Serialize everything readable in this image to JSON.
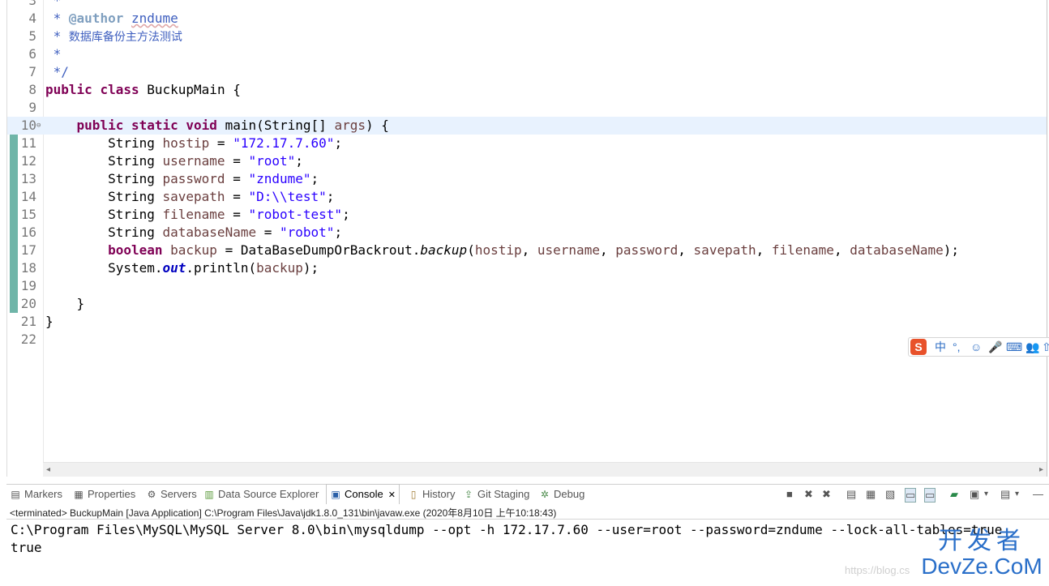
{
  "editor": {
    "lines": [
      {
        "n": "3",
        "segs": [
          {
            "t": " *",
            "c": "cm"
          }
        ]
      },
      {
        "n": "4",
        "segs": [
          {
            "t": " * ",
            "c": "cm"
          },
          {
            "t": "@author",
            "c": "tag"
          },
          {
            "t": " ",
            "c": "cm"
          },
          {
            "t": "zndume",
            "c": "tagv"
          }
        ]
      },
      {
        "n": "5",
        "segs": [
          {
            "t": " * ",
            "c": "cm"
          },
          {
            "t": "数据库备份主方法测试",
            "c": "cm cjk"
          }
        ]
      },
      {
        "n": "6",
        "segs": [
          {
            "t": " *",
            "c": "cm"
          }
        ]
      },
      {
        "n": "7",
        "segs": [
          {
            "t": " */",
            "c": "cm"
          }
        ]
      },
      {
        "n": "8",
        "segs": [
          {
            "t": "public",
            "c": "kw"
          },
          {
            "t": " "
          },
          {
            "t": "class",
            "c": "kw"
          },
          {
            "t": " BuckupMain {"
          }
        ]
      },
      {
        "n": "9",
        "segs": []
      },
      {
        "n": "10",
        "fold": "⊖",
        "current": true,
        "segs": [
          {
            "t": "    "
          },
          {
            "t": "public",
            "c": "kw"
          },
          {
            "t": " "
          },
          {
            "t": "static",
            "c": "kw"
          },
          {
            "t": " "
          },
          {
            "t": "void",
            "c": "kw"
          },
          {
            "t": " main(String[] "
          },
          {
            "t": "args",
            "c": "var"
          },
          {
            "t": ") {"
          }
        ]
      },
      {
        "n": "11",
        "segs": [
          {
            "t": "        String "
          },
          {
            "t": "hostip",
            "c": "var"
          },
          {
            "t": " = "
          },
          {
            "t": "\"172.17.7.60\"",
            "c": "str"
          },
          {
            "t": ";"
          }
        ]
      },
      {
        "n": "12",
        "segs": [
          {
            "t": "        String "
          },
          {
            "t": "username",
            "c": "var"
          },
          {
            "t": " = "
          },
          {
            "t": "\"root\"",
            "c": "str"
          },
          {
            "t": ";"
          }
        ]
      },
      {
        "n": "13",
        "segs": [
          {
            "t": "        String "
          },
          {
            "t": "password",
            "c": "var"
          },
          {
            "t": " = "
          },
          {
            "t": "\"zndume\"",
            "c": "str"
          },
          {
            "t": ";"
          }
        ]
      },
      {
        "n": "14",
        "segs": [
          {
            "t": "        String "
          },
          {
            "t": "savepath",
            "c": "var"
          },
          {
            "t": " = "
          },
          {
            "t": "\"D:\\\\test\"",
            "c": "str"
          },
          {
            "t": ";"
          }
        ]
      },
      {
        "n": "15",
        "segs": [
          {
            "t": "        String "
          },
          {
            "t": "filename",
            "c": "var"
          },
          {
            "t": " = "
          },
          {
            "t": "\"robot-test\"",
            "c": "str"
          },
          {
            "t": ";"
          }
        ]
      },
      {
        "n": "16",
        "segs": [
          {
            "t": "        String "
          },
          {
            "t": "databaseName",
            "c": "var"
          },
          {
            "t": " = "
          },
          {
            "t": "\"robot\"",
            "c": "str"
          },
          {
            "t": ";"
          }
        ]
      },
      {
        "n": "17",
        "segs": [
          {
            "t": "        "
          },
          {
            "t": "boolean",
            "c": "kw"
          },
          {
            "t": " "
          },
          {
            "t": "backup",
            "c": "var"
          },
          {
            "t": " = DataBaseDumpOrBackrout."
          },
          {
            "t": "backup",
            "c": "it"
          },
          {
            "t": "("
          },
          {
            "t": "hostip",
            "c": "var"
          },
          {
            "t": ", "
          },
          {
            "t": "username",
            "c": "var"
          },
          {
            "t": ", "
          },
          {
            "t": "password",
            "c": "var"
          },
          {
            "t": ", "
          },
          {
            "t": "savepath",
            "c": "var"
          },
          {
            "t": ", "
          },
          {
            "t": "filename",
            "c": "var"
          },
          {
            "t": ", "
          },
          {
            "t": "databaseName",
            "c": "var"
          },
          {
            "t": ");"
          }
        ]
      },
      {
        "n": "18",
        "segs": [
          {
            "t": "        System."
          },
          {
            "t": "out",
            "c": "fld"
          },
          {
            "t": ".println("
          },
          {
            "t": "backup",
            "c": "var"
          },
          {
            "t": ");"
          }
        ]
      },
      {
        "n": "19",
        "segs": []
      },
      {
        "n": "20",
        "segs": [
          {
            "t": "    }"
          }
        ]
      },
      {
        "n": "21",
        "segs": [
          {
            "t": "}"
          }
        ]
      },
      {
        "n": "22",
        "segs": []
      }
    ]
  },
  "ime": {
    "logo": "S",
    "lang": "中",
    "punct": "°,",
    "emoji": "☺",
    "mic": "🎤",
    "keyboard": "⌨",
    "user": "👥",
    "more": "⇧"
  },
  "panel": {
    "tabs": {
      "markers": "Markers",
      "properties": "Properties",
      "servers": "Servers",
      "datasource": "Data Source Explorer",
      "console": "Console",
      "history": "History",
      "gitstaging": "Git Staging",
      "debug": "Debug"
    },
    "status": "<terminated> BuckupMain [Java Application] C:\\Program Files\\Java\\jdk1.8.0_131\\bin\\javaw.exe (2020年8月10日 上午10:18:43)",
    "console_lines": [
      "C:\\Program Files\\MySQL\\MySQL Server 8.0\\bin\\mysqldump --opt -h 172.17.7.60 --user=root --password=zndume --lock-all-tables=true",
      "true"
    ]
  },
  "watermark": {
    "cn": "开发者",
    "en": "DevZe.CoM",
    "url": "https://blog.cs"
  },
  "colors": {
    "keyword": "#7f0055",
    "string": "#2a00ff",
    "comment": "#3f5fbf",
    "variable": "#6a3e3e",
    "current_line": "#e8f2fe"
  }
}
